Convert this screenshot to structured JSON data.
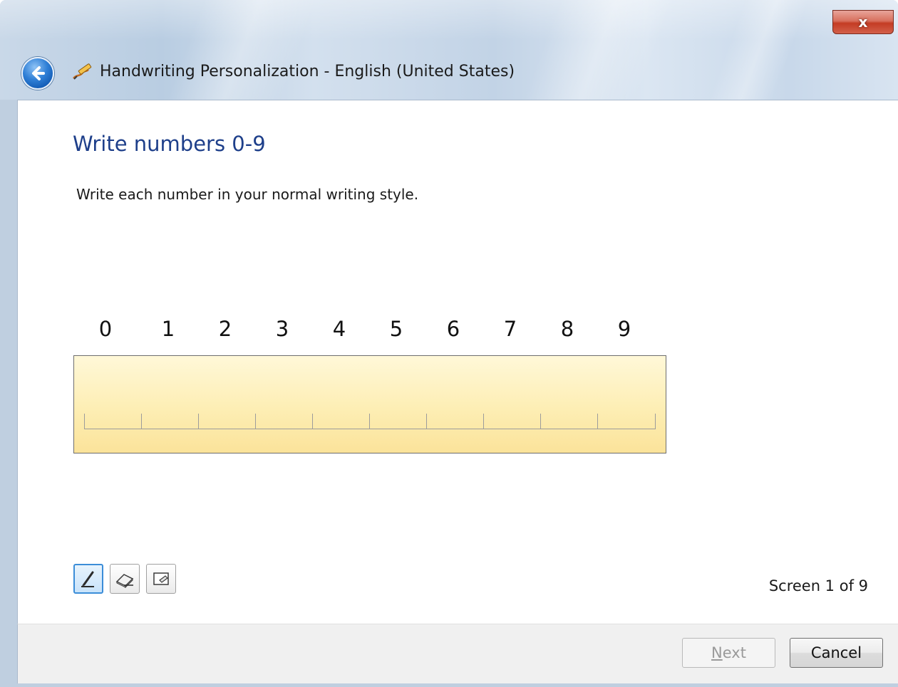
{
  "window": {
    "title": "Handwriting Personalization - English (United States)",
    "close_label": "x"
  },
  "page": {
    "heading": "Write numbers 0-9",
    "instruction": "Write each number in your normal writing style."
  },
  "digits": [
    "0",
    "1",
    "2",
    "3",
    "4",
    "5",
    "6",
    "7",
    "8",
    "9"
  ],
  "tools": [
    {
      "name": "pen-tool",
      "icon": "pen-icon",
      "active": true
    },
    {
      "name": "eraser-tool",
      "icon": "eraser-icon",
      "active": false
    },
    {
      "name": "clear-tool",
      "icon": "clear-icon",
      "active": false
    }
  ],
  "status": {
    "screen_count": "Screen 1 of 9"
  },
  "footer": {
    "next_label": "Next",
    "next_mnemonic": "N",
    "cancel_label": "Cancel"
  },
  "colors": {
    "heading": "#1e3f8a",
    "pad_fill": "#fdeeb4",
    "close_red": "#c43c24"
  }
}
